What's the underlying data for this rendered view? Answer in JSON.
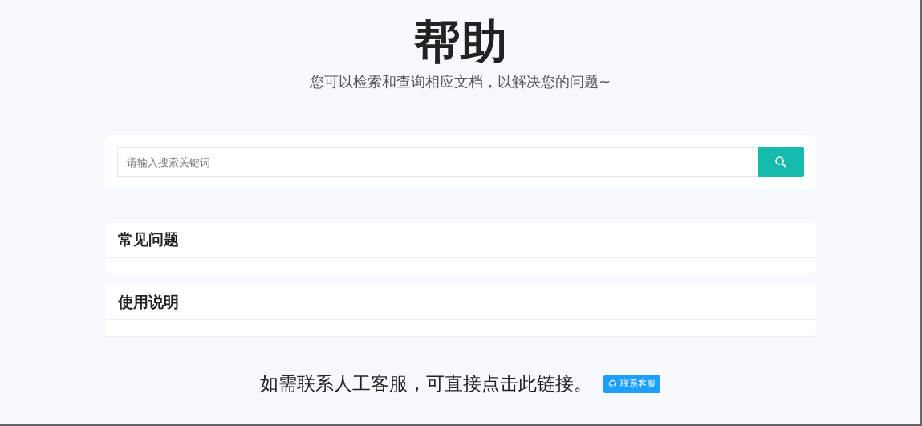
{
  "title": "帮助",
  "subtitle": "您可以检索和查询相应文档，以解决您的问题~",
  "search": {
    "placeholder": "请输入搜索关键词"
  },
  "sections": [
    {
      "title": "常见问题"
    },
    {
      "title": "使用说明"
    }
  ],
  "contact": {
    "text": "如需联系人工客服，可直接点击此链接。",
    "button": "联系客服"
  }
}
